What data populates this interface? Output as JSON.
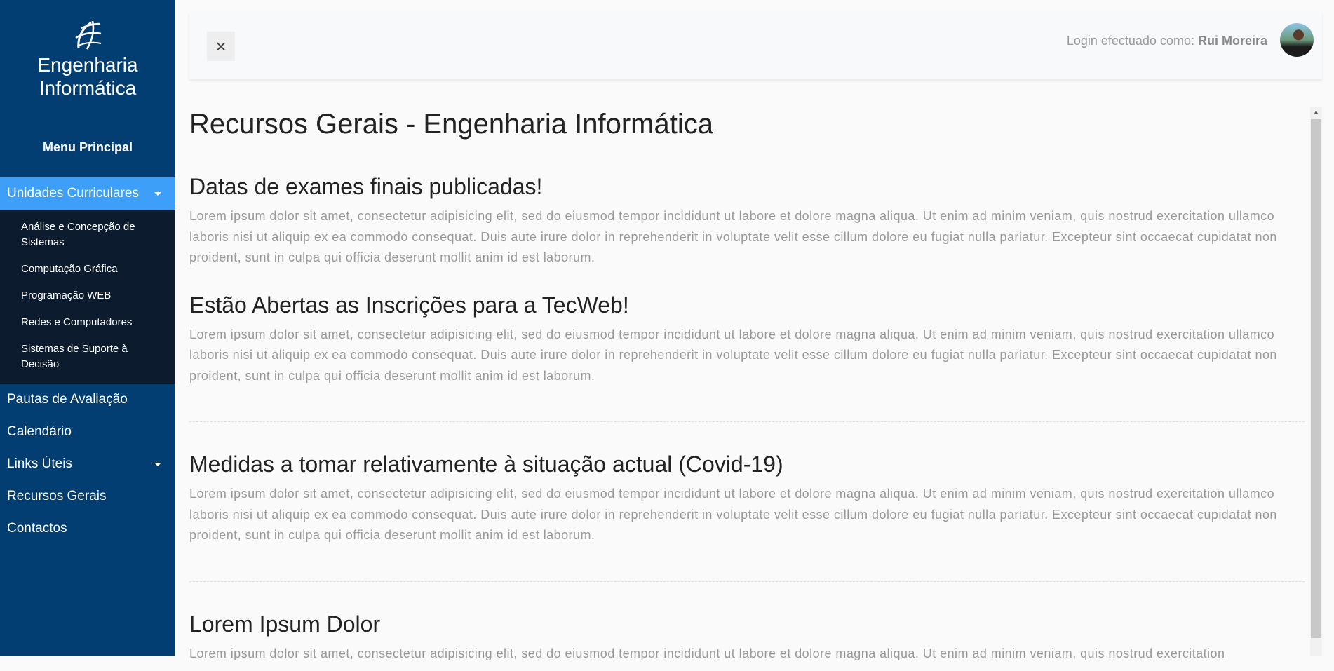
{
  "sidebar": {
    "brand_line1": "Engenharia",
    "brand_line2": "Informática",
    "menu_title": "Menu Principal",
    "active_item": "Unidades Curriculares",
    "submenu": [
      "Análise e Concepção de Sistemas",
      "Computação Gráfica",
      "Programação WEB",
      "Redes e Computadores",
      "Sistemas de Suporte à Decisão"
    ],
    "items": [
      "Pautas de Avaliação",
      "Calendário",
      "Links Úteis",
      "Recursos Gerais",
      "Contactos"
    ],
    "colors": {
      "background": "#033e73",
      "active": "#3d9ff8",
      "submenu": "#0c1c2e"
    }
  },
  "header": {
    "close_icon": "close-icon",
    "login_prefix": "Login efectuado como: ",
    "user_name": "Rui Moreira"
  },
  "main": {
    "title": "Recursos Gerais - Engenharia Informática",
    "articles": [
      {
        "title": "Datas de exames finais publicadas!",
        "body": "Lorem ipsum dolor sit amet, consectetur adipisicing elit, sed do eiusmod tempor incididunt ut labore et dolore magna aliqua. Ut enim ad minim veniam, quis nostrud exercitation ullamco laboris nisi ut aliquip ex ea commodo consequat. Duis aute irure dolor in reprehenderit in voluptate velit esse cillum dolore eu fugiat nulla pariatur. Excepteur sint occaecat cupidatat non proident, sunt in culpa qui officia deserunt mollit anim id est laborum."
      },
      {
        "title": "Estão Abertas as Inscrições para a TecWeb!",
        "body": "Lorem ipsum dolor sit amet, consectetur adipisicing elit, sed do eiusmod tempor incididunt ut labore et dolore magna aliqua. Ut enim ad minim veniam, quis nostrud exercitation ullamco laboris nisi ut aliquip ex ea commodo consequat. Duis aute irure dolor in reprehenderit in voluptate velit esse cillum dolore eu fugiat nulla pariatur. Excepteur sint occaecat cupidatat non proident, sunt in culpa qui officia deserunt mollit anim id est laborum."
      },
      {
        "title": "Medidas a tomar relativamente à situação actual (Covid-19)",
        "body": "Lorem ipsum dolor sit amet, consectetur adipisicing elit, sed do eiusmod tempor incididunt ut labore et dolore magna aliqua. Ut enim ad minim veniam, quis nostrud exercitation ullamco laboris nisi ut aliquip ex ea commodo consequat. Duis aute irure dolor in reprehenderit in voluptate velit esse cillum dolore eu fugiat nulla pariatur. Excepteur sint occaecat cupidatat non proident, sunt in culpa qui officia deserunt mollit anim id est laborum."
      },
      {
        "title": "Lorem Ipsum Dolor",
        "body": "Lorem ipsum dolor sit amet, consectetur adipisicing elit, sed do eiusmod tempor incididunt ut labore et dolore magna aliqua. Ut enim ad minim veniam, quis nostrud exercitation"
      }
    ]
  }
}
